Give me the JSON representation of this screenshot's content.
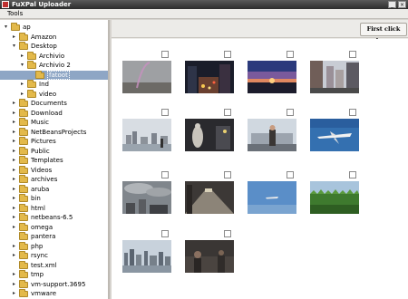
{
  "window": {
    "title": "FuXPal Uploader",
    "minimize": "_",
    "close": "×"
  },
  "menubar": {
    "tools": "Tools"
  },
  "tree": {
    "items": [
      {
        "label": "ap",
        "depth": 0,
        "expanded": true
      },
      {
        "label": "Amazon",
        "depth": 1,
        "expanded": false
      },
      {
        "label": "Desktop",
        "depth": 1,
        "expanded": true
      },
      {
        "label": "Archivio",
        "depth": 2,
        "expanded": false
      },
      {
        "label": "Archivio 2",
        "depth": 2,
        "expanded": true
      },
      {
        "label": "fatoot",
        "depth": 3,
        "expanded": null,
        "selected": true
      },
      {
        "label": "Ind",
        "depth": 2,
        "expanded": false
      },
      {
        "label": "video",
        "depth": 2,
        "expanded": false
      },
      {
        "label": "Documents",
        "depth": 1,
        "expanded": false
      },
      {
        "label": "Download",
        "depth": 1,
        "expanded": false
      },
      {
        "label": "Music",
        "depth": 1,
        "expanded": false
      },
      {
        "label": "NetBeansProjects",
        "depth": 1,
        "expanded": false
      },
      {
        "label": "Pictures",
        "depth": 1,
        "expanded": false
      },
      {
        "label": "Public",
        "depth": 1,
        "expanded": false
      },
      {
        "label": "Templates",
        "depth": 1,
        "expanded": false
      },
      {
        "label": "Videos",
        "depth": 1,
        "expanded": false
      },
      {
        "label": "archives",
        "depth": 1,
        "expanded": false
      },
      {
        "label": "aruba",
        "depth": 1,
        "expanded": false
      },
      {
        "label": "bin",
        "depth": 1,
        "expanded": false
      },
      {
        "label": "html",
        "depth": 1,
        "expanded": false
      },
      {
        "label": "netbeans-6.5",
        "depth": 1,
        "expanded": false
      },
      {
        "label": "omega",
        "depth": 1,
        "expanded": false
      },
      {
        "label": "pantera",
        "depth": 1,
        "expanded": null
      },
      {
        "label": "php",
        "depth": 1,
        "expanded": false
      },
      {
        "label": "rsync",
        "depth": 1,
        "expanded": false
      },
      {
        "label": "test.xml",
        "depth": 1,
        "expanded": null
      },
      {
        "label": "tmp",
        "depth": 1,
        "expanded": false
      },
      {
        "label": "vm-support.3695",
        "depth": 1,
        "expanded": false
      },
      {
        "label": "vmware",
        "depth": 1,
        "expanded": false
      }
    ]
  },
  "toolbar": {
    "first_click_label": "First click here"
  },
  "thumbnails": [
    {
      "scene": "rainbow-sky",
      "checked": false
    },
    {
      "scene": "city-night-street",
      "checked": false
    },
    {
      "scene": "sunset-horizon",
      "checked": false
    },
    {
      "scene": "city-street-buildings",
      "checked": false
    },
    {
      "scene": "city-skyline-water",
      "checked": false
    },
    {
      "scene": "night-statue",
      "checked": false
    },
    {
      "scene": "person-skyline",
      "checked": false
    },
    {
      "scene": "airplane-blue-sky",
      "checked": false
    },
    {
      "scene": "clouds-buildings",
      "checked": false
    },
    {
      "scene": "subway-platform",
      "checked": false
    },
    {
      "scene": "airplane-distant",
      "checked": false
    },
    {
      "scene": "corn-field",
      "checked": false
    },
    {
      "scene": "skyline-river",
      "checked": false
    },
    {
      "scene": "dark-crowd",
      "checked": false
    }
  ],
  "colors": {
    "selection": "#8ea6c5",
    "folder": "#e3b94a"
  }
}
